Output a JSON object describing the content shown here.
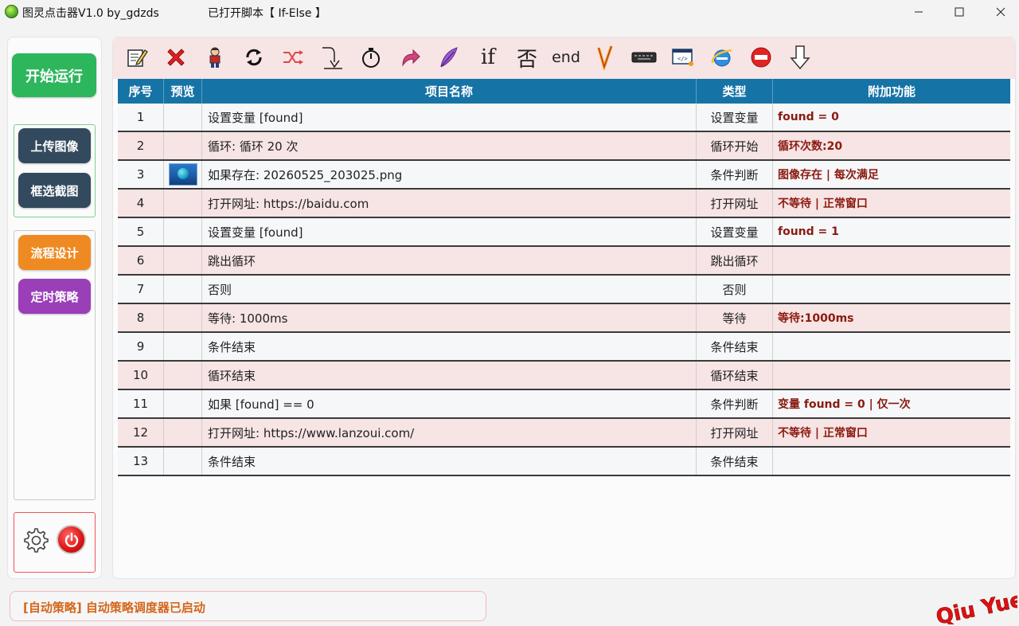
{
  "window": {
    "app_title": "图灵点击器V1.0 by_gdzds",
    "script_title": "已打开脚本【 If-Else 】",
    "controls": [
      "minimize-icon",
      "maximize-icon",
      "close-icon"
    ]
  },
  "sidebar": {
    "start_label": "开始运行",
    "upload_label": "上传图像",
    "crop_label": "框选截图",
    "flow_label": "流程设计",
    "timer_label": "定时策略",
    "settings_icon": "gear-icon",
    "power_icon": "power-icon"
  },
  "toolbar": {
    "tools": [
      "edit-icon",
      "delete-icon",
      "character-icon",
      "refresh-icon",
      "shuffle-icon",
      "jump-down-icon",
      "stopwatch-icon",
      "redirect-icon",
      "feather-icon",
      "if",
      "否",
      "end",
      "v-check-icon",
      "keyboard-icon",
      "code-window-icon",
      "internet-explorer-icon",
      "stop-icon",
      "arrow-down-icon"
    ],
    "if_label": "if",
    "else_label": "否",
    "end_label": "end"
  },
  "table": {
    "headers": {
      "no": "序号",
      "preview": "预览",
      "name": "项目名称",
      "type": "类型",
      "extra": "附加功能"
    },
    "rows": [
      {
        "no": "1",
        "has_preview": false,
        "name": "设置变量 [found]",
        "type": "设置变量",
        "extra": "found = 0"
      },
      {
        "no": "2",
        "has_preview": false,
        "name": "循环: 循环 20 次",
        "type": "循环开始",
        "extra": "循环次数:20"
      },
      {
        "no": "3",
        "has_preview": true,
        "name": "如果存在: 20260525_203025.png",
        "type": "条件判断",
        "extra": "图像存在 | 每次满足"
      },
      {
        "no": "4",
        "has_preview": false,
        "name": "打开网址: https://baidu.com",
        "type": "打开网址",
        "extra": "不等待 | 正常窗口"
      },
      {
        "no": "5",
        "has_preview": false,
        "name": "设置变量 [found]",
        "type": "设置变量",
        "extra": "found = 1"
      },
      {
        "no": "6",
        "has_preview": false,
        "name": "跳出循环",
        "type": "跳出循环",
        "extra": ""
      },
      {
        "no": "7",
        "has_preview": false,
        "name": "否则",
        "type": "否则",
        "extra": ""
      },
      {
        "no": "8",
        "has_preview": false,
        "name": "等待: 1000ms",
        "type": "等待",
        "extra": "等待:1000ms"
      },
      {
        "no": "9",
        "has_preview": false,
        "name": "条件结束",
        "type": "条件结束",
        "extra": ""
      },
      {
        "no": "10",
        "has_preview": false,
        "name": "循环结束",
        "type": "循环结束",
        "extra": ""
      },
      {
        "no": "11",
        "has_preview": false,
        "name": "如果 [found] == 0",
        "type": "条件判断",
        "extra": "变量 found = 0 | 仅一次"
      },
      {
        "no": "12",
        "has_preview": false,
        "name": "打开网址: https://www.lanzoui.com/",
        "type": "打开网址",
        "extra": "不等待 | 正常窗口"
      },
      {
        "no": "13",
        "has_preview": false,
        "name": "条件结束",
        "type": "条件结束",
        "extra": ""
      }
    ]
  },
  "status": {
    "message": "[自动策略] 自动策略调度器已启动"
  },
  "watermark": "Qiu Yue",
  "colors": {
    "header_bg": "#1673a6",
    "start_green": "#2db65c",
    "dark_button": "#334a5e",
    "orange": "#ef8a22",
    "purple": "#9a3fb8",
    "extra_text": "#8b1a10",
    "row_pink": "#f7e4e4",
    "status_text": "#d4661b"
  }
}
